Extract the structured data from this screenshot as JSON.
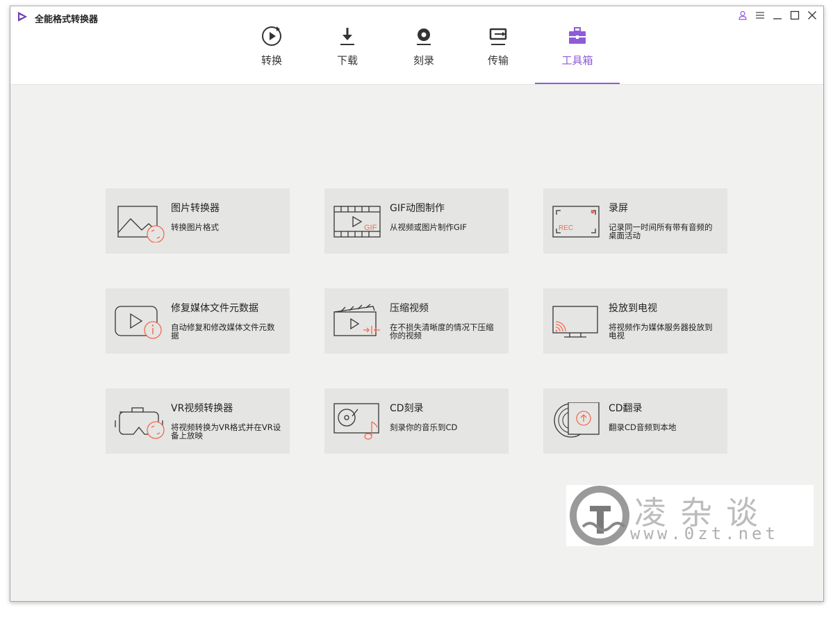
{
  "app": {
    "title": "全能格式转换器"
  },
  "window_controls": [
    {
      "name": "account-icon"
    },
    {
      "name": "menu-icon"
    },
    {
      "name": "minimize-icon"
    },
    {
      "name": "maximize-icon"
    },
    {
      "name": "close-icon"
    }
  ],
  "tabs": [
    {
      "id": "convert",
      "label": "转换",
      "icon": "convert-icon",
      "active": false
    },
    {
      "id": "download",
      "label": "下载",
      "icon": "download-icon",
      "active": false
    },
    {
      "id": "burn",
      "label": "刻录",
      "icon": "burn-icon",
      "active": false
    },
    {
      "id": "transfer",
      "label": "传输",
      "icon": "transfer-icon",
      "active": false
    },
    {
      "id": "toolbox",
      "label": "工具箱",
      "icon": "toolbox-icon",
      "active": true
    }
  ],
  "tools": [
    {
      "id": "image-converter",
      "title": "图片转换器",
      "desc": "转换图片格式",
      "icon": "image-converter-icon"
    },
    {
      "id": "gif-maker",
      "title": "GIF动图制作",
      "desc": "从视频或图片制作GIF",
      "icon": "gif-maker-icon"
    },
    {
      "id": "screen-recorder",
      "title": "录屏",
      "desc": "记录同一时间所有带有音频的桌面活动",
      "icon": "screen-recorder-icon"
    },
    {
      "id": "fix-metadata",
      "title": "修复媒体文件元数据",
      "desc": "自动修复和修改媒体文件元数据",
      "icon": "metadata-icon"
    },
    {
      "id": "compress-video",
      "title": "压缩视频",
      "desc": "在不损失清晰度的情况下压缩你的视频",
      "icon": "compress-icon"
    },
    {
      "id": "cast-to-tv",
      "title": "投放到电视",
      "desc": "将视频作为媒体服务器投放到电视",
      "icon": "cast-tv-icon"
    },
    {
      "id": "vr-converter",
      "title": "VR视频转换器",
      "desc": "将视频转换为VR格式并在VR设备上放映",
      "icon": "vr-icon"
    },
    {
      "id": "cd-burner",
      "title": "CD刻录",
      "desc": "刻录你的音乐到CD",
      "icon": "cd-burn-icon"
    },
    {
      "id": "cd-ripper",
      "title": "CD翻录",
      "desc": "翻录CD音频到本地",
      "icon": "cd-rip-icon"
    }
  ],
  "gif_badge": "GIF",
  "rec_badge": "REC",
  "watermark": {
    "name": "凌杂谈",
    "url": "www.0zt.net"
  },
  "colors": {
    "accent": "#8e5cd9",
    "highlight": "#f26b4f",
    "card": "#e5e5e4",
    "background": "#f1f1f0"
  }
}
